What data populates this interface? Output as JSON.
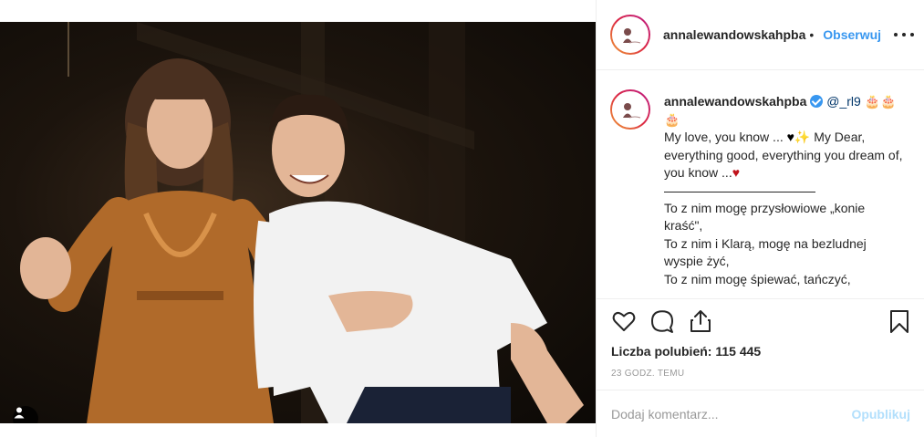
{
  "post": {
    "username": "annalewandowskahpba",
    "follow_label": "Obserwuj",
    "separator": "•"
  },
  "caption": {
    "username": "annalewandowskahpba",
    "mention": "@_rl9",
    "cake_emoji": "🎂🎂",
    "cake_emoji_2": "🎂",
    "line1_a": "My love, you know ... ",
    "heart_black": "♥",
    "sparkle": "✨",
    "line1_b": " My Dear, everything good, everything you dream of, you know ...",
    "heart_red": "♥",
    "pl_line1": "To z nim mogę przysłowiowe „konie kraść\",",
    "pl_line2": "To z nim i Klarą, mogę na bezludnej wyspie żyć,",
    "pl_line3": "To z nim mogę śpiewać, tańczyć,"
  },
  "engagement": {
    "likes_label": "Liczba polubień:",
    "likes_count": "115 445",
    "timestamp": "23 GODZ. TEMU"
  },
  "comment_box": {
    "placeholder": "Dodaj komentarz...",
    "publish_label": "Opublikuj"
  },
  "colors": {
    "accent": "#3897f0",
    "publish_disabled": "#b2dffc",
    "dress": "#b06a2a"
  },
  "icons": [
    "user-tag-icon",
    "more-options-icon",
    "heart-icon",
    "comment-icon",
    "share-icon",
    "bookmark-icon",
    "verified-badge-icon"
  ]
}
